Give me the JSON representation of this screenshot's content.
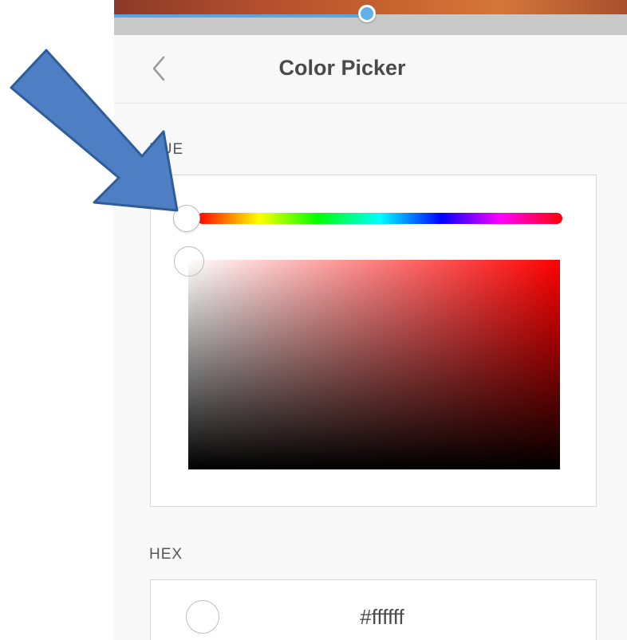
{
  "header": {
    "title": "Color Picker",
    "back_icon": "chevron-left-icon"
  },
  "hue_section": {
    "label": "HUE",
    "slider_value": 0,
    "selected_hue_color": "#ff0000",
    "saturation": 0,
    "brightness": 1
  },
  "hex_section": {
    "label": "HEX",
    "value": "#ffffff",
    "swatch_color": "#ffffff"
  },
  "top_slider": {
    "value_fraction": 0.5,
    "accent_color": "#62b0ea"
  },
  "annotation": {
    "icon": "arrow-annotation-icon",
    "color": "#4e7fc4"
  }
}
